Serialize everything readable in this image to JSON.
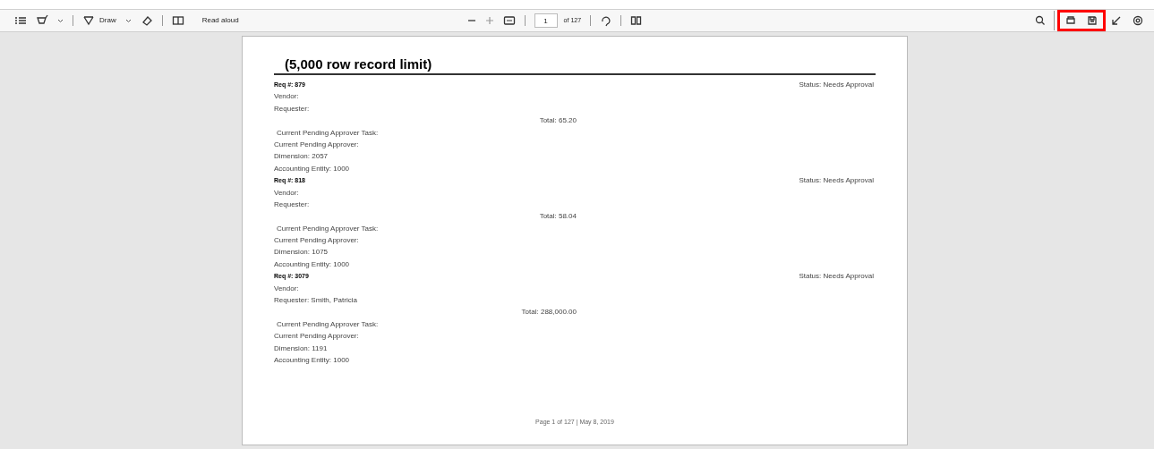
{
  "toolbar": {
    "left": [
      {
        "kind": "contents"
      },
      {
        "kind": "highlight"
      },
      {
        "kind": "caret"
      },
      {
        "kind": "sep"
      },
      {
        "kind": "draw",
        "label": "Draw"
      },
      {
        "kind": "caret"
      },
      {
        "kind": "eraser"
      },
      {
        "kind": "sep"
      },
      {
        "kind": "view"
      },
      {
        "kind": "read",
        "label": "Read aloud"
      }
    ],
    "center": {
      "page": "1",
      "of": "of 127"
    },
    "right": [
      {
        "kind": "search",
        "highlighted": false
      },
      {
        "kind": "sep",
        "highlighted": false
      },
      {
        "kind": "print",
        "highlighted": true
      },
      {
        "kind": "save",
        "highlighted": true
      },
      {
        "kind": "expand",
        "highlighted": false
      },
      {
        "kind": "settings",
        "highlighted": false
      }
    ]
  },
  "document": {
    "title": "(5,000 row record limit)",
    "records": [
      {
        "req": "Req #: 879",
        "vendor": "Vendor:",
        "requester": "Requester:",
        "status": "Status: Needs Approval",
        "total": "Total: 65.20",
        "task": "Current Pending Approver Task:",
        "approver": "Current Pending Approver:",
        "dimension": "Dimension: 2057",
        "entity": "Accounting Entity: 1000"
      },
      {
        "req": "Req #: 818",
        "vendor": "Vendor:",
        "requester": "Requester:",
        "status": "Status: Needs Approval",
        "total": "Total: 58.04",
        "task": "Current Pending Approver Task:",
        "approver": "Current Pending Approver:",
        "dimension": "Dimension: 1075",
        "entity": "Accounting Entity: 1000"
      },
      {
        "req": "Req #: 3079",
        "vendor": "Vendor:",
        "requester": "Requester: Smith, Patricia",
        "status": "Status: Needs Approval",
        "total": "Total: 288,000.00",
        "task": "Current Pending Approver Task:",
        "approver": "Current Pending Approver:",
        "dimension": "Dimension: 1191",
        "entity": "Accounting Entity: 1000"
      }
    ],
    "footer": "Page 1 of 127 | May 8, 2019"
  }
}
